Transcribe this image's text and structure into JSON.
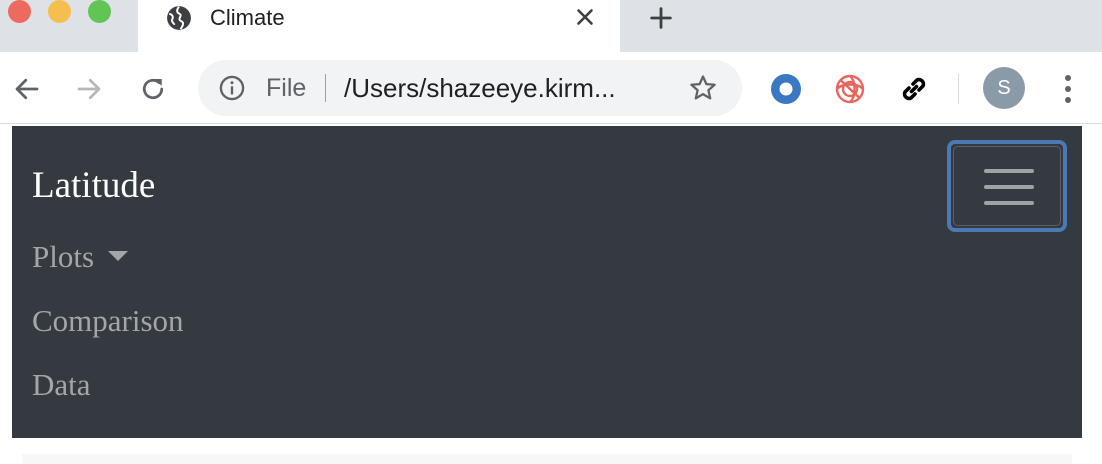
{
  "browser": {
    "tab": {
      "title": "Climate",
      "favicon": "globe-icon"
    },
    "toolbar": {
      "back_icon": "back-arrow-icon",
      "forward_icon": "forward-arrow-icon",
      "reload_icon": "reload-icon",
      "omnibox": {
        "scheme_label": "File",
        "url": "/Users/shazeeye.kirm..."
      },
      "extensions": [
        "blue-circle-extension-icon",
        "pink-swirl-extension-icon",
        "link-icon"
      ],
      "profile_initial": "S"
    }
  },
  "page": {
    "navbar": {
      "brand": "Latitude",
      "items": [
        {
          "label": "Plots",
          "dropdown": true
        },
        {
          "label": "Comparison",
          "dropdown": false
        },
        {
          "label": "Data",
          "dropdown": false
        }
      ]
    }
  },
  "colors": {
    "navbar_bg": "#343a40",
    "toggler_focus": "#4a79b3",
    "nav_link": "#a3a6aa",
    "brand": "#ffffff"
  }
}
